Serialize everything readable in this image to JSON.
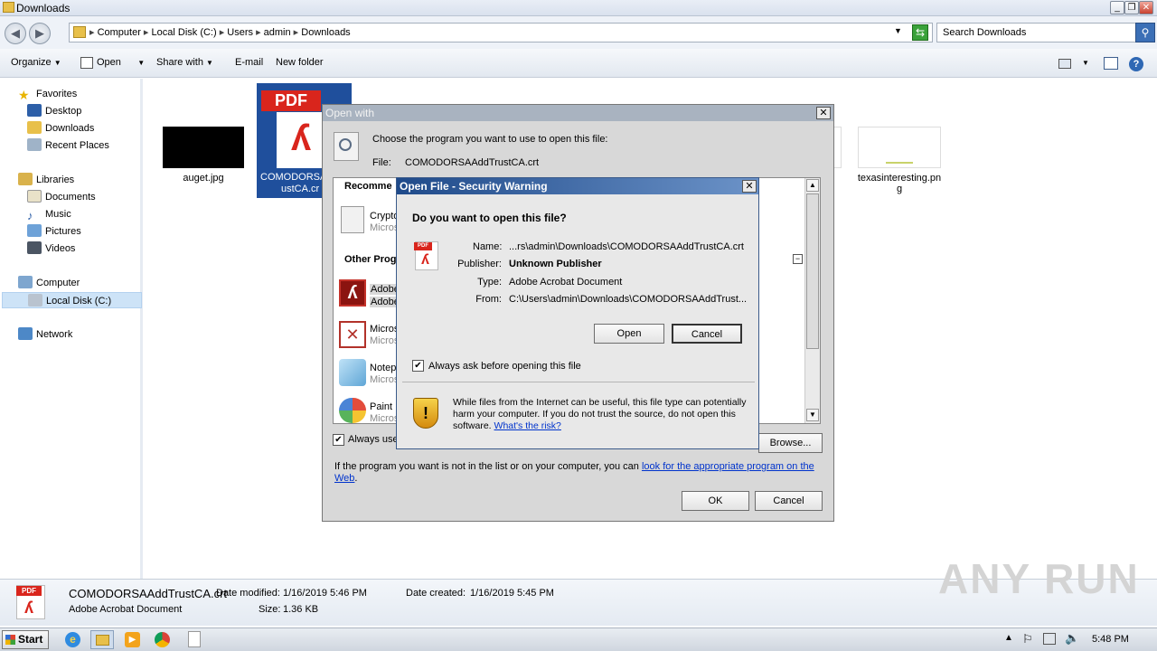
{
  "window": {
    "title": "Downloads"
  },
  "breadcrumb": [
    "Computer",
    "Local Disk (C:)",
    "Users",
    "admin",
    "Downloads"
  ],
  "search": {
    "placeholder": "Search Downloads"
  },
  "toolbar": {
    "organize": "Organize",
    "open": "Open",
    "share_with": "Share with",
    "email": "E-mail",
    "new_folder": "New folder"
  },
  "nav": {
    "favorites": "Favorites",
    "desktop": "Desktop",
    "downloads": "Downloads",
    "recent_places": "Recent Places",
    "libraries": "Libraries",
    "documents": "Documents",
    "music": "Music",
    "pictures": "Pictures",
    "videos": "Videos",
    "computer": "Computer",
    "local_disk": "Local Disk (C:)",
    "network": "Network"
  },
  "files": {
    "auget": "auget.jpg",
    "comodo_line1": "COMODORSA",
    "comodo_line2": "ustCA.cr",
    "pdf_tag": "PDF",
    "texas_line1": "texasinteresting.pn",
    "texas_line2": "g"
  },
  "details": {
    "file_name": "COMODORSAAddTrustCA.crt",
    "file_type": "Adobe Acrobat Document",
    "modified_label": "Date modified:",
    "modified_value": "1/16/2019 5:46 PM",
    "created_label": "Date created:",
    "created_value": "1/16/2019 5:45 PM",
    "size_label": "Size:",
    "size_value": "1.36 KB"
  },
  "taskbar": {
    "start": "Start",
    "clock": "5:48 PM"
  },
  "watermark": "ANY RUN",
  "open_with": {
    "title": "Open with",
    "prompt": "Choose the program you want to use to open this file:",
    "file_label": "File:",
    "file_value": "COMODORSAAddTrustCA.crt",
    "recommended": "Recomme",
    "other_programs": "Other Prog",
    "programs": [
      {
        "name": "Crypto",
        "vendor": "Micros"
      },
      {
        "name": "Adobe",
        "vendor": "Adobe"
      },
      {
        "name": "Micros",
        "vendor": "Micros"
      },
      {
        "name": "Notep",
        "vendor": "Micros"
      },
      {
        "name": "Paint",
        "vendor": "Micros"
      }
    ],
    "always_use": "Always use",
    "browse": "Browse...",
    "hint_text": "If the program you want is not in the list or on your computer, you can ",
    "hint_link1": "look for the appropriate program on the",
    "hint_link2": "Web",
    "hint_end": ".",
    "ok": "OK",
    "cancel": "Cancel"
  },
  "security": {
    "title": "Open File - Security Warning",
    "question": "Do you want to open this file?",
    "name_label": "Name:",
    "name_value": "...rs\\admin\\Downloads\\COMODORSAAddTrustCA.crt",
    "publisher_label": "Publisher:",
    "publisher_value": "Unknown Publisher",
    "type_label": "Type:",
    "type_value": "Adobe Acrobat Document",
    "from_label": "From:",
    "from_value": "C:\\Users\\admin\\Downloads\\COMODORSAAddTrust...",
    "open": "Open",
    "cancel": "Cancel",
    "always_ask": "Always ask before opening this file",
    "warning": "While files from the Internet can be useful, this file type can potentially harm your computer. If you do not trust the source, do not open this software. ",
    "risk_link": "What's the risk?"
  }
}
